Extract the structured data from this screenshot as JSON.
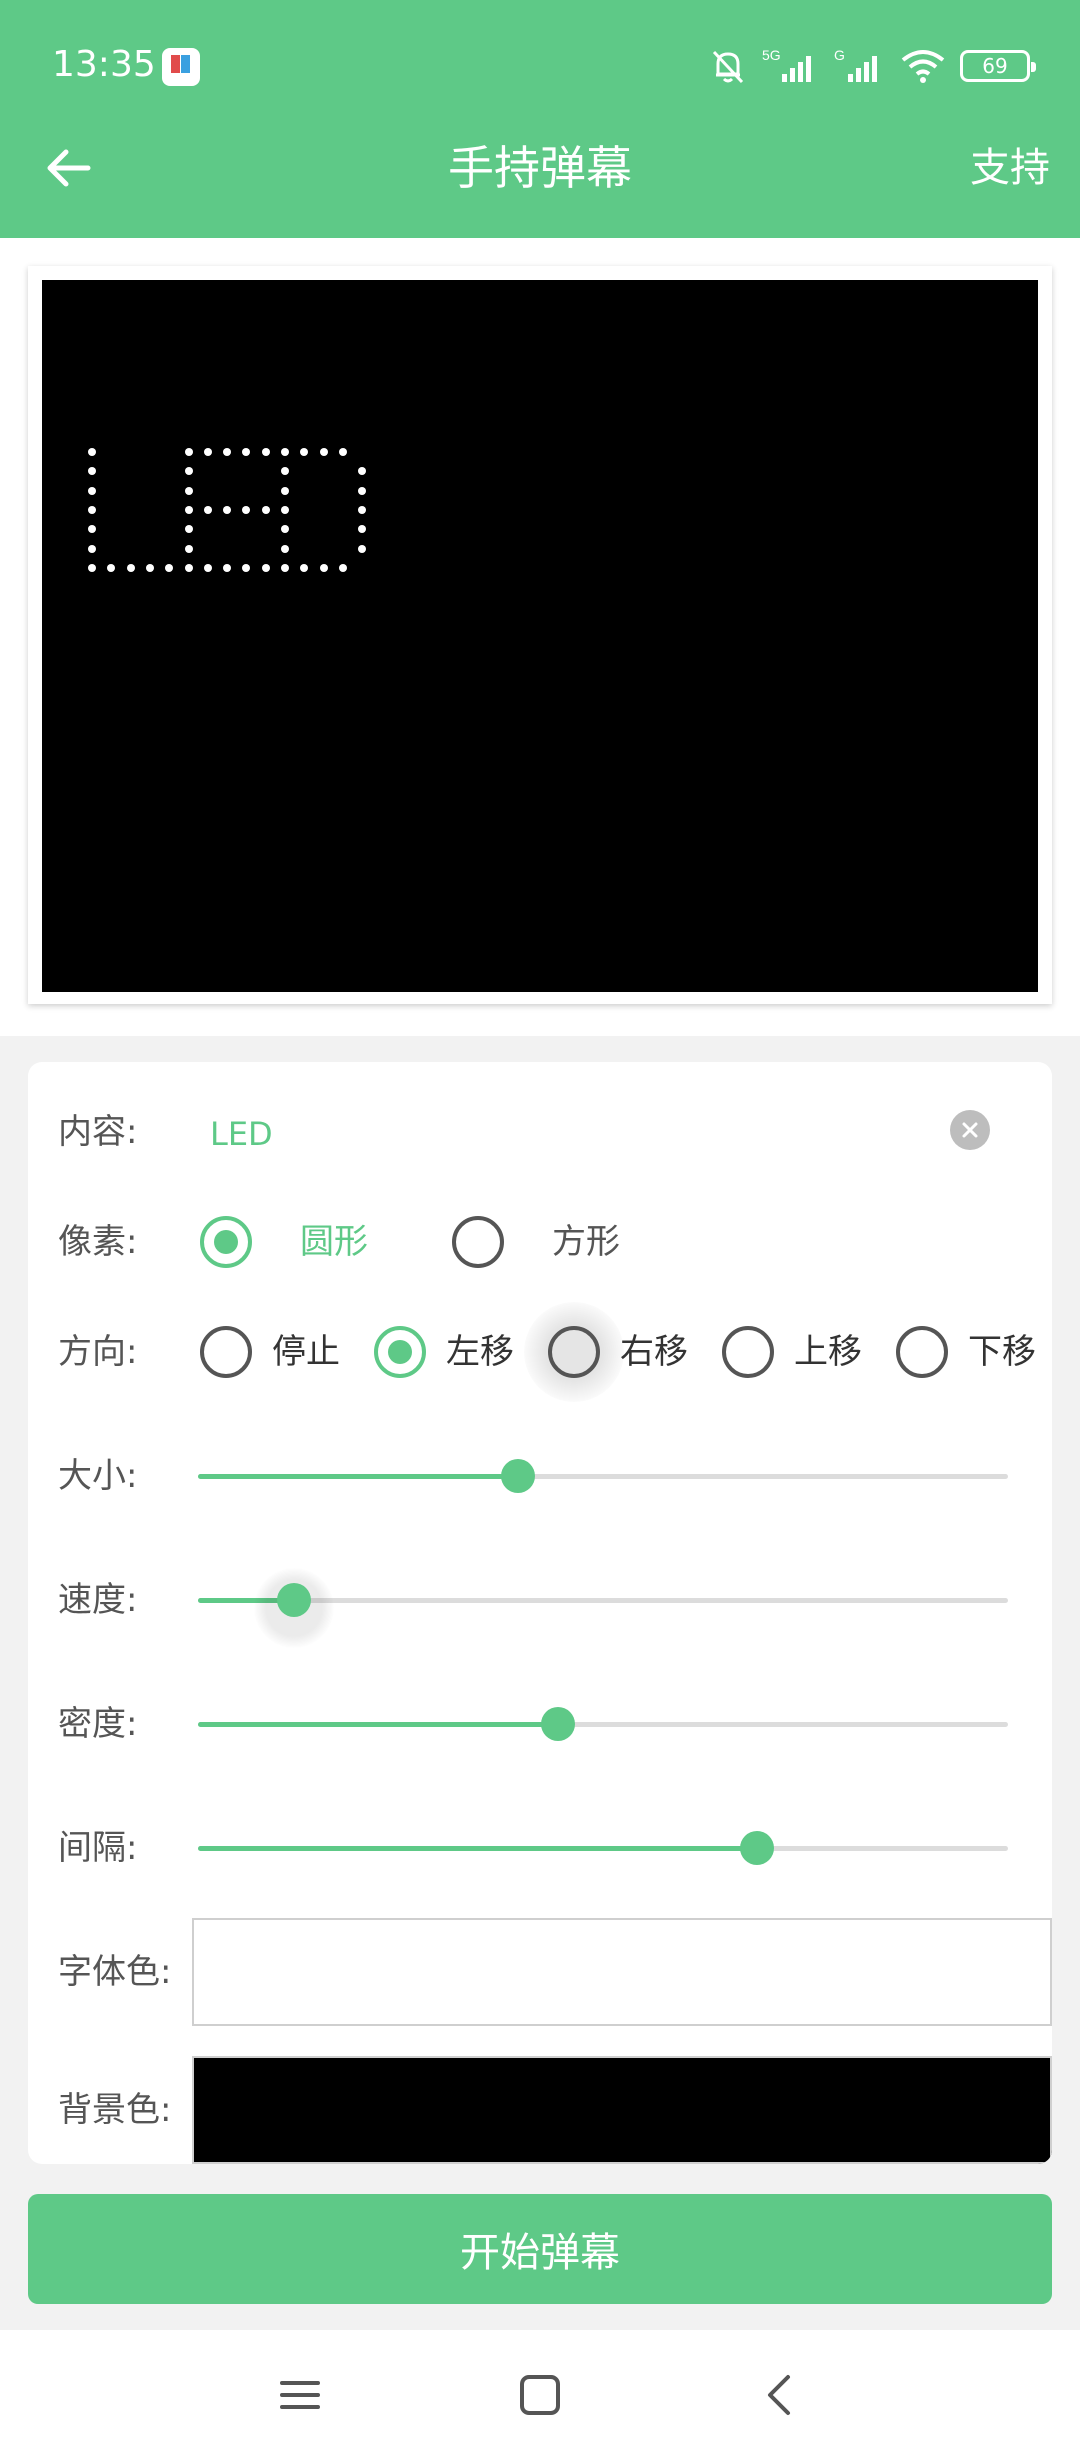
{
  "status": {
    "time": "13:35",
    "battery": "69",
    "network1": "5G",
    "network2": "G"
  },
  "header": {
    "title": "手持弹幕",
    "action": "支持"
  },
  "preview": {
    "text": "LED",
    "font_color": "#ffffff",
    "background_color": "#000000"
  },
  "settings": {
    "content": {
      "label": "内容:",
      "value": "LED"
    },
    "pixel": {
      "label": "像素:",
      "options": [
        "圆形",
        "方形"
      ],
      "selected": "圆形"
    },
    "direction": {
      "label": "方向:",
      "options": [
        "停止",
        "左移",
        "右移",
        "上移",
        "下移"
      ],
      "selected": "左移"
    },
    "size": {
      "label": "大小:",
      "value": 0.395
    },
    "speed": {
      "label": "速度:",
      "value": 0.118
    },
    "density": {
      "label": "密度:",
      "value": 0.445
    },
    "interval": {
      "label": "间隔:",
      "value": 0.69
    },
    "font_color": {
      "label": "字体色:",
      "color": "#ffffff"
    },
    "background_color": {
      "label": "背景色:",
      "color": "#000000"
    }
  },
  "start_button": "开始弹幕",
  "colors": {
    "accent": "#5ec987"
  }
}
